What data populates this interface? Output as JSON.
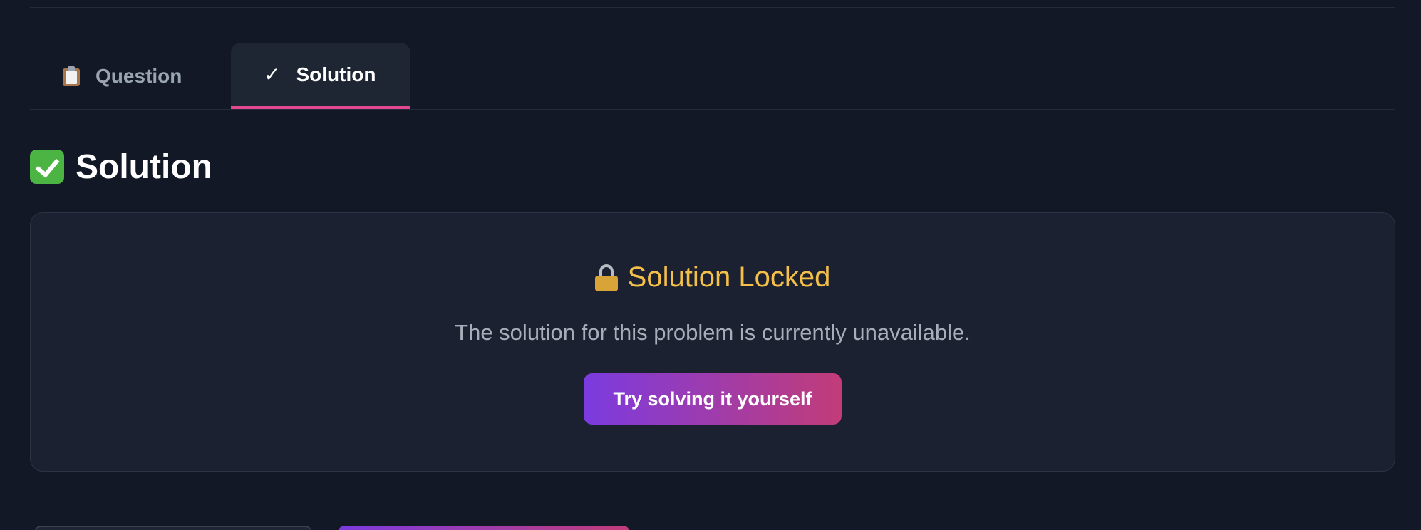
{
  "tabs": [
    {
      "label": "Question",
      "icon": "clipboard-icon",
      "active": false
    },
    {
      "label": "Solution",
      "icon": "check-icon",
      "active": true
    }
  ],
  "section": {
    "title": "Solution",
    "icon": "check-box-icon"
  },
  "locked_card": {
    "title": "Solution Locked",
    "icon": "lock-icon",
    "message": "The solution for this problem is currently unavailable.",
    "button_label": "Try solving it yourself"
  },
  "colors": {
    "background": "#121826",
    "card": "#1b2130",
    "accent_pink": "#e2478f",
    "locked_title": "#f5c04a",
    "button_gradient_start": "#7b3be0",
    "button_gradient_end": "#c23c78",
    "check_green": "#4cb443"
  }
}
